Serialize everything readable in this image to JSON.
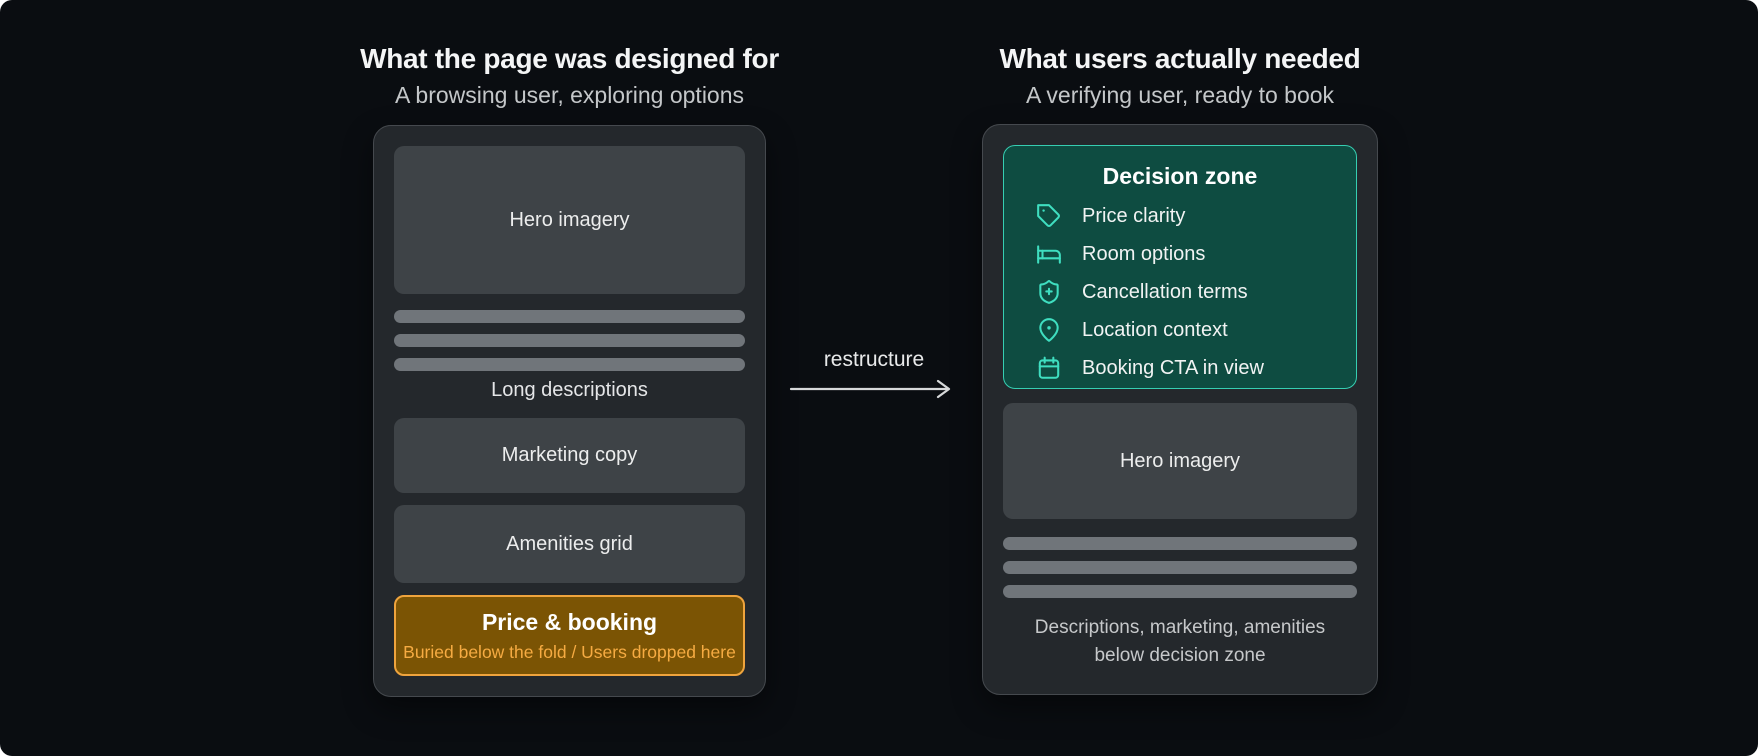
{
  "left": {
    "title": "What the page was designed for",
    "subtitle": "A browsing user, exploring options",
    "hero_label": "Hero imagery",
    "skeleton_caption": "Long descriptions",
    "marketing_label": "Marketing copy",
    "amenities_label": "Amenities grid",
    "price_block": {
      "title": "Price & booking",
      "subtitle": "Buried below the fold / Users dropped here"
    }
  },
  "arrow": {
    "label": "restructure"
  },
  "right": {
    "title": "What users actually needed",
    "subtitle": "A verifying user, ready to book",
    "decision_zone": {
      "title": "Decision zone",
      "items": [
        {
          "icon": "tag-icon",
          "label": "Price clarity"
        },
        {
          "icon": "bed-icon",
          "label": "Room options"
        },
        {
          "icon": "shield-plus-icon",
          "label": "Cancellation terms"
        },
        {
          "icon": "location-pin-icon",
          "label": "Location context"
        },
        {
          "icon": "calendar-icon",
          "label": "Booking CTA in view"
        }
      ]
    },
    "hero_label": "Hero imagery",
    "caption_lines": [
      "Descriptions, marketing, amenities",
      "below decision zone"
    ]
  },
  "colors": {
    "page_bg": "#0a0d11",
    "card_bg": "#24282c",
    "card_border": "#45494e",
    "block_bg": "#3e4347",
    "skeleton_bar": "#70757a",
    "teal_zone_bg": "#0e4c41",
    "teal_accent": "#36ceb2",
    "teal_icon": "#3fdec0",
    "amber_block_bg": "#7b5404",
    "amber_accent": "#efa43d",
    "amber_text": "#f6ab42"
  }
}
